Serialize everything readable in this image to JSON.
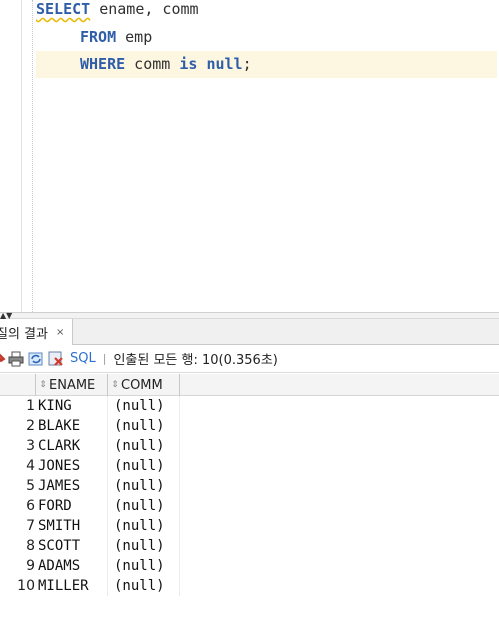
{
  "editor": {
    "line1": {
      "kw": "SELECT",
      "rest": " ename, comm"
    },
    "line2": {
      "kw": "FROM",
      "rest": " emp"
    },
    "line3": {
      "kw1": "WHERE",
      "mid": " comm ",
      "kw2": "is",
      "sp": " ",
      "kw3": "null",
      "end": ";"
    }
  },
  "results_tab": {
    "label": "질의 결과",
    "close": "×"
  },
  "toolbar": {
    "sql_label": "SQL",
    "separator": "|",
    "status": "인출된 모든 행: 10(0.356초)",
    "icons": [
      "pin-icon",
      "print-icon",
      "refresh-icon",
      "cancel-icon"
    ]
  },
  "grid": {
    "columns": [
      "ENAME",
      "COMM"
    ],
    "rows": [
      {
        "n": "1",
        "ename": "KING",
        "comm": "(null)"
      },
      {
        "n": "2",
        "ename": "BLAKE",
        "comm": "(null)"
      },
      {
        "n": "3",
        "ename": "CLARK",
        "comm": "(null)"
      },
      {
        "n": "4",
        "ename": "JONES",
        "comm": "(null)"
      },
      {
        "n": "5",
        "ename": "JAMES",
        "comm": "(null)"
      },
      {
        "n": "6",
        "ename": "FORD",
        "comm": "(null)"
      },
      {
        "n": "7",
        "ename": "SMITH",
        "comm": "(null)"
      },
      {
        "n": "8",
        "ename": "SCOTT",
        "comm": "(null)"
      },
      {
        "n": "9",
        "ename": "ADAMS",
        "comm": "(null)"
      },
      {
        "n": "10",
        "ename": "MILLER",
        "comm": "(null)"
      }
    ]
  },
  "colors": {
    "keyword": "#2f5ea9",
    "current_line": "#fdf6e1",
    "link": "#2f6fd0"
  }
}
